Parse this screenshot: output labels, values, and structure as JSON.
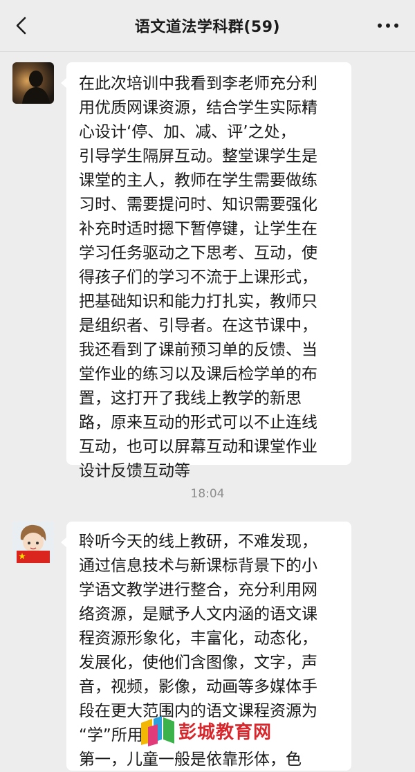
{
  "header": {
    "title": "语文道法学科群(59)"
  },
  "messages": [
    {
      "text": "在此次培训中我看到李老师充分利\n用优质网课资源，结合学生实际精\n心设计‘停、加、减、评’之处，\n引导学生隔屏互动。整堂课学生是\n课堂的主人，教师在学生需要做练\n习时、需要提问时、知识需要强化\n补充时适时摁下暂停键，让学生在\n学习任务驱动之下思考、互动，使\n得孩子们的学习不流于上课形式，\n把基础知识和能力打扎实，教师只\n是组织者、引导者。在这节课中，\n我还看到了课前预习单的反馈、当\n堂作业的练习以及课后检学单的布\n置，这打开了我线上教学的新思\n路，原来互动的形式可以不止连线\n互动，也可以屏幕互动和课堂作业\n设计反馈互动等"
    },
    {
      "text": "聆听今天的线上教研，不难发现，\n通过信息技术与新课标背景下的小\n学语文教学进行整合，充分利用网\n络资源，是赋予人文内涵的语文课\n程资源形象化，丰富化，动态化，\n发展化，使他们含图像，文字，声\n音，视频，影像，动画等多媒体手\n段在更大范围内的语文课程资源为\n“学”所用。\n 第一，儿童一般是依靠形体，色"
    }
  ],
  "timestamp": "18:04",
  "watermark": {
    "text": "彭城教育网"
  },
  "icons": {
    "back": "back-arrow-icon",
    "more": "more-dots-icon"
  },
  "colors": {
    "background": "#ededed",
    "bubble": "#ffffff",
    "watermark_red": "#d8272c"
  }
}
